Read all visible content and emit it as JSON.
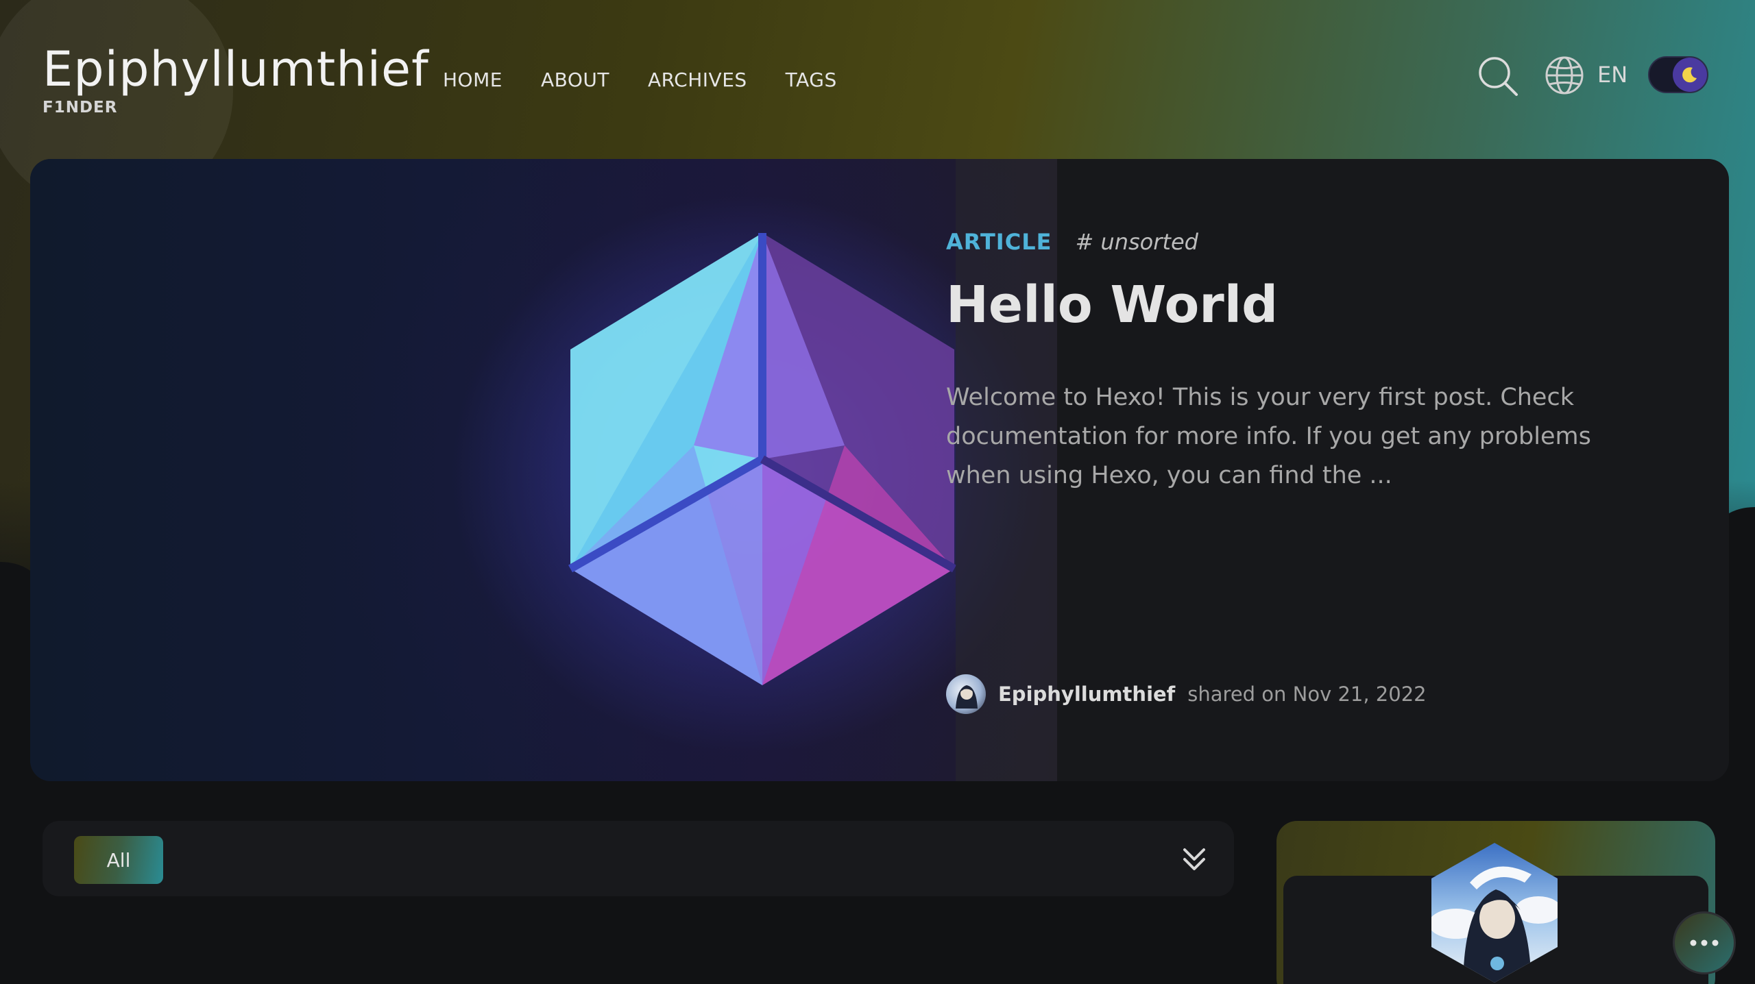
{
  "header": {
    "site_title": "Epiphyllumthief",
    "site_subtitle": "F1NDER",
    "nav": [
      {
        "label": "HOME"
      },
      {
        "label": "ABOUT"
      },
      {
        "label": "ARCHIVES"
      },
      {
        "label": "TAGS"
      }
    ],
    "language": "EN"
  },
  "hero": {
    "category": "ARTICLE",
    "tag": "# unsorted",
    "title": "Hello World",
    "excerpt": "Welcome to Hexo! This is your very first post. Check documentation for more info. If you get any problems when using Hexo, you can find the ...",
    "author": "Epiphyllumthief",
    "shared_text": "shared on Nov 21, 2022"
  },
  "filter": {
    "active_chip": "All"
  },
  "colors": {
    "accent": "#4fb3d9",
    "background": "#111214",
    "card": "#17181b"
  }
}
